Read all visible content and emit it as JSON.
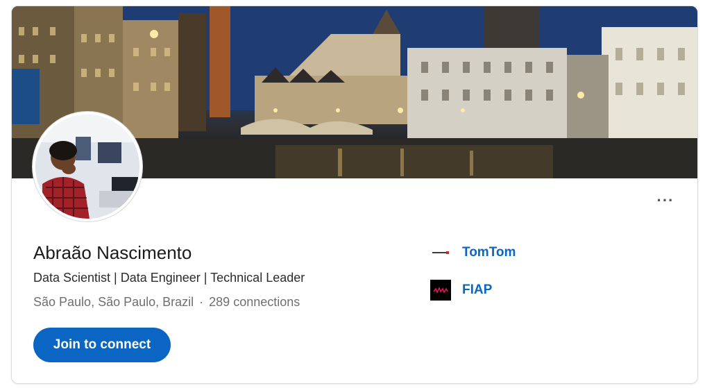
{
  "profile": {
    "name": "Abraão Nascimento",
    "headline": "Data Scientist | Data Engineer | Technical Leader",
    "location": "São Paulo, São Paulo, Brazil",
    "separator": "·",
    "connections": "289 connections"
  },
  "actions": {
    "join_label": "Join to connect",
    "more_label": "···"
  },
  "experience": [
    {
      "name": "TomTom",
      "logo_text": "TOMTOM"
    },
    {
      "name": "FIAP",
      "logo_text": "FIAP"
    }
  ],
  "colors": {
    "accent": "#0a66c2",
    "text_primary": "#1b1b1b",
    "text_secondary": "#6f6f6f"
  }
}
